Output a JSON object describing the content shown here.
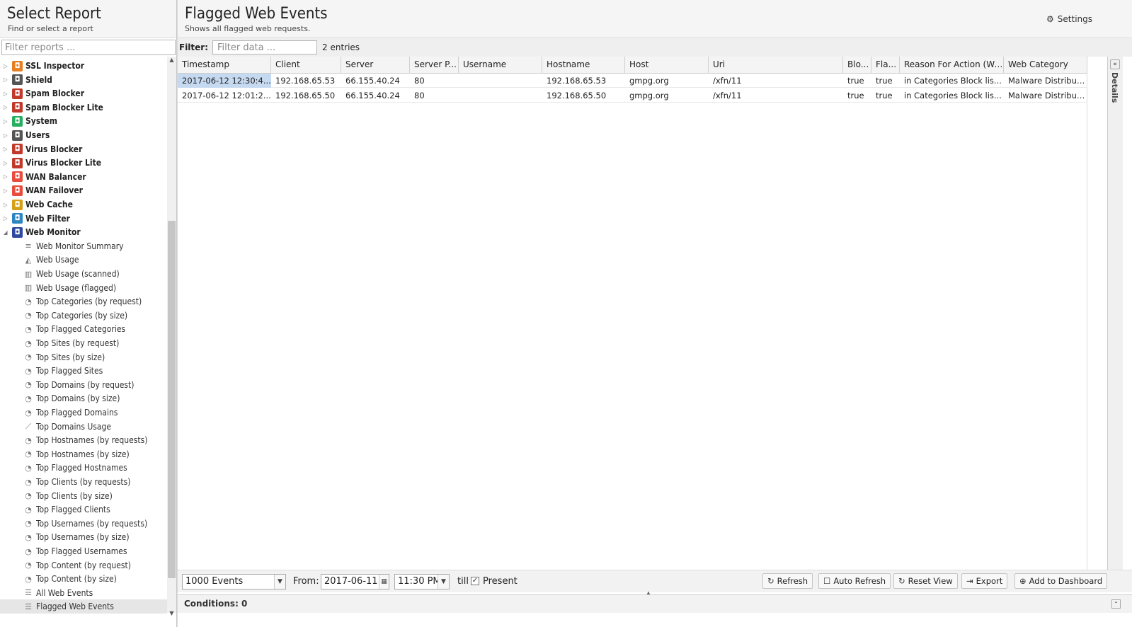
{
  "left": {
    "title": "Select Report",
    "subtitle": "Find or select a report",
    "filter_placeholder": "Filter reports ...",
    "parents": [
      {
        "label": "SSL Inspector",
        "icon": "ssl-inspector-icon",
        "color": "#e67e22"
      },
      {
        "label": "Shield",
        "icon": "shield-icon",
        "color": "#555555"
      },
      {
        "label": "Spam Blocker",
        "icon": "spam-blocker-icon",
        "color": "#c0392b"
      },
      {
        "label": "Spam Blocker Lite",
        "icon": "spam-blocker-lite-icon",
        "color": "#c0392b"
      },
      {
        "label": "System",
        "icon": "system-icon",
        "color": "#27ae60"
      },
      {
        "label": "Users",
        "icon": "users-icon",
        "color": "#555555"
      },
      {
        "label": "Virus Blocker",
        "icon": "virus-blocker-icon",
        "color": "#c0392b"
      },
      {
        "label": "Virus Blocker Lite",
        "icon": "virus-blocker-lite-icon",
        "color": "#c0392b"
      },
      {
        "label": "WAN Balancer",
        "icon": "wan-balancer-icon",
        "color": "#e74c3c"
      },
      {
        "label": "WAN Failover",
        "icon": "wan-failover-icon",
        "color": "#e74c3c"
      },
      {
        "label": "Web Cache",
        "icon": "web-cache-icon",
        "color": "#d4a017"
      },
      {
        "label": "Web Filter",
        "icon": "web-filter-icon",
        "color": "#2e86c1"
      },
      {
        "label": "Web Monitor",
        "icon": "web-monitor-icon",
        "color": "#2e4a9e"
      }
    ],
    "children": [
      {
        "label": "Web Monitor Summary",
        "icon": "text-lines-icon"
      },
      {
        "label": "Web Usage",
        "icon": "area-chart-icon"
      },
      {
        "label": "Web Usage (scanned)",
        "icon": "bar-chart-icon"
      },
      {
        "label": "Web Usage (flagged)",
        "icon": "bar-chart-icon"
      },
      {
        "label": "Top Categories (by request)",
        "icon": "pie-chart-icon"
      },
      {
        "label": "Top Categories (by size)",
        "icon": "pie-chart-icon"
      },
      {
        "label": "Top Flagged Categories",
        "icon": "pie-chart-icon"
      },
      {
        "label": "Top Sites (by request)",
        "icon": "pie-chart-icon"
      },
      {
        "label": "Top Sites (by size)",
        "icon": "pie-chart-icon"
      },
      {
        "label": "Top Flagged Sites",
        "icon": "pie-chart-icon"
      },
      {
        "label": "Top Domains (by request)",
        "icon": "pie-chart-icon"
      },
      {
        "label": "Top Domains (by size)",
        "icon": "pie-chart-icon"
      },
      {
        "label": "Top Flagged Domains",
        "icon": "pie-chart-icon"
      },
      {
        "label": "Top Domains Usage",
        "icon": "line-chart-icon"
      },
      {
        "label": "Top Hostnames (by requests)",
        "icon": "pie-chart-icon"
      },
      {
        "label": "Top Hostnames (by size)",
        "icon": "pie-chart-icon"
      },
      {
        "label": "Top Flagged Hostnames",
        "icon": "pie-chart-icon"
      },
      {
        "label": "Top Clients (by requests)",
        "icon": "pie-chart-icon"
      },
      {
        "label": "Top Clients (by size)",
        "icon": "pie-chart-icon"
      },
      {
        "label": "Top Flagged Clients",
        "icon": "pie-chart-icon"
      },
      {
        "label": "Top Usernames (by requests)",
        "icon": "pie-chart-icon"
      },
      {
        "label": "Top Usernames (by size)",
        "icon": "pie-chart-icon"
      },
      {
        "label": "Top Flagged Usernames",
        "icon": "pie-chart-icon"
      },
      {
        "label": "Top Content (by request)",
        "icon": "pie-chart-icon"
      },
      {
        "label": "Top Content (by size)",
        "icon": "pie-chart-icon"
      },
      {
        "label": "All Web Events",
        "icon": "list-icon"
      },
      {
        "label": "Flagged Web Events",
        "icon": "list-icon",
        "selected": true
      }
    ]
  },
  "main": {
    "title": "Flagged Web Events",
    "subtitle": "Shows all flagged web requests.",
    "settings_label": "Settings",
    "filter_label": "Filter:",
    "filter_placeholder": "Filter data ...",
    "entries": "2 entries",
    "columns": [
      "Timestamp",
      "Client",
      "Server",
      "Server P...",
      "Username",
      "Hostname",
      "Host",
      "Uri",
      "Blo...",
      "Fla...",
      "Reason For Action (We...",
      "Web Category"
    ],
    "rows": [
      [
        "2017-06-12 12:30:4...",
        "192.168.65.53",
        "66.155.40.24",
        "80",
        "",
        "192.168.65.53",
        "gmpg.org",
        "/xfn/11",
        "true",
        "true",
        "in Categories Block lis...",
        "Malware Distribut..."
      ],
      [
        "2017-06-12 12:01:2...",
        "192.168.65.50",
        "66.155.40.24",
        "80",
        "",
        "192.168.65.50",
        "gmpg.org",
        "/xfn/11",
        "true",
        "true",
        "in Categories Block lis...",
        "Malware Distribut..."
      ]
    ],
    "details_label": "Details",
    "toolbar": {
      "events_value": "1000 Events",
      "from_label": "From:",
      "from_date": "2017-06-11",
      "from_time": "11:30 PM",
      "till_label": "till",
      "present_label": "Present",
      "present_checked": true,
      "refresh": "Refresh",
      "auto_refresh": "Auto Refresh",
      "reset_view": "Reset View",
      "export": "Export",
      "add_dashboard": "Add to Dashboard"
    },
    "conditions": "Conditions: 0"
  }
}
